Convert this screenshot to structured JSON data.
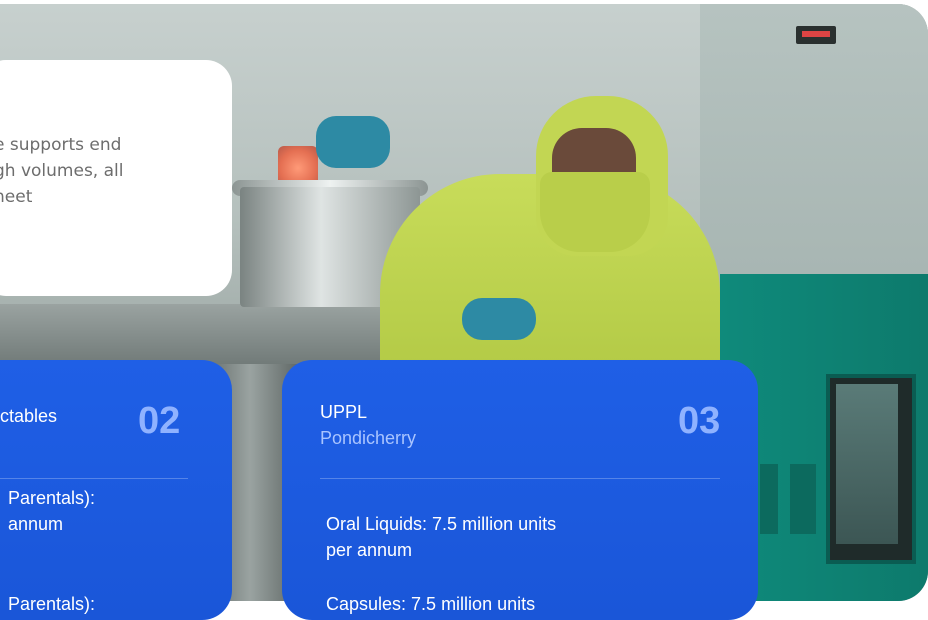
{
  "info_card": {
    "lines": [
      "e supports end",
      "gh volumes, all",
      "neet"
    ]
  },
  "cards": [
    {
      "title": "ctables",
      "number": "02",
      "lines": [
        "Parentals):",
        "annum",
        "Parentals):"
      ]
    },
    {
      "title": "UPPL",
      "subtitle": "Pondicherry",
      "number": "03",
      "lines": [
        "Oral Liquids: 7.5 million units",
        "per annum",
        "Capsules: 7.5 million units"
      ]
    }
  ],
  "colors": {
    "card_blue": "#1a56d8",
    "card_number": "#8fb2ff",
    "subtitle": "#a9c4ff",
    "body_text": "#6d6d6d"
  }
}
